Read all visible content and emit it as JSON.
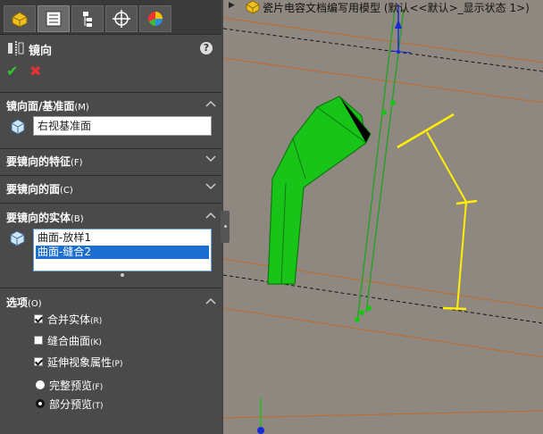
{
  "property_manager": {
    "feature_title": "镜向",
    "help_label": "?",
    "ok_label": "✔",
    "cancel_label": "✖",
    "tabs": [
      {
        "name": "feature-manager-icon"
      },
      {
        "name": "property-manager-icon"
      },
      {
        "name": "configuration-manager-icon"
      },
      {
        "name": "dimxpert-icon"
      },
      {
        "name": "display-manager-icon"
      }
    ],
    "sections": {
      "mirror_plane": {
        "title": "镜向面/基准面",
        "shortcut": "(M)",
        "value": "右视基准面"
      },
      "features": {
        "title": "要镜向的特征",
        "shortcut": "(F)"
      },
      "faces": {
        "title": "要镜向的面",
        "shortcut": "(C)"
      },
      "bodies": {
        "title": "要镜向的实体",
        "shortcut": "(B)",
        "items": [
          "曲面-放样1",
          "曲面-缝合2"
        ],
        "selected_index": 1
      }
    },
    "options": {
      "title": "选项",
      "shortcut": "(O)",
      "checkboxes": [
        {
          "label": "合并实体",
          "shortcut": "(R)",
          "checked": true
        },
        {
          "label": "缝合曲面",
          "shortcut": "(K)",
          "checked": false
        },
        {
          "label": "延伸视象属性",
          "shortcut": "(P)",
          "checked": true
        }
      ],
      "radios": [
        {
          "label": "完整预览",
          "shortcut": "(F)",
          "checked": false
        },
        {
          "label": "部分预览",
          "shortcut": "(T)",
          "checked": true
        }
      ]
    }
  },
  "viewport": {
    "document_title": "瓷片电容文档编写用模型  (默认<<默认>_显示状态 1>)",
    "colors": {
      "background": "#8f8880",
      "preview_body": "#19c419",
      "mirror_plane": "#2e9e2e",
      "sketch": "#ffef00",
      "guide_line": "#c06a2a"
    }
  }
}
